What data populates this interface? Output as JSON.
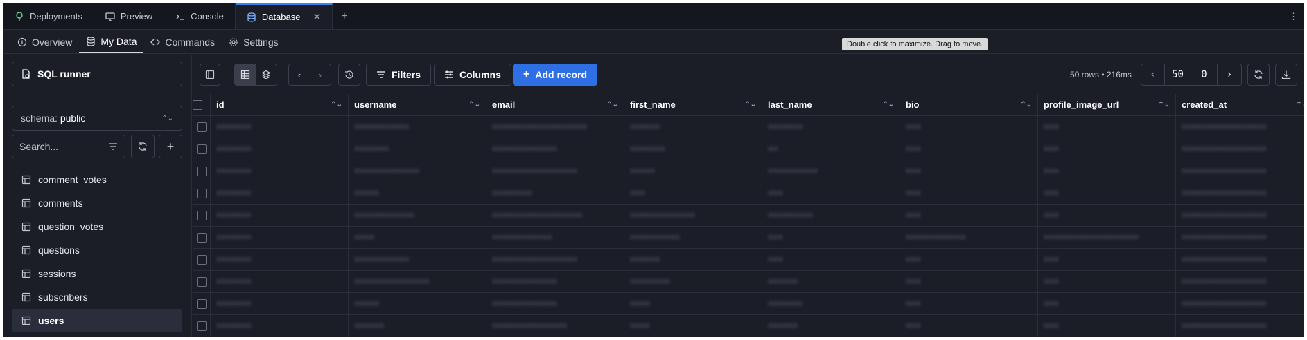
{
  "tabs": [
    {
      "label": "Deployments",
      "icon": "tree-icon"
    },
    {
      "label": "Preview",
      "icon": "monitor-icon"
    },
    {
      "label": "Console",
      "icon": "terminal-icon"
    },
    {
      "label": "Database",
      "icon": "database-icon",
      "active": true
    }
  ],
  "subnav": {
    "overview": "Overview",
    "my_data": "My Data",
    "commands": "Commands",
    "settings": "Settings"
  },
  "tooltip": "Double click to maximize. Drag to move.",
  "sidebar": {
    "sql_runner": "SQL runner",
    "schema_label": "schema:",
    "schema_value": "public",
    "search_placeholder": "Search...",
    "tables": [
      "comment_votes",
      "comments",
      "question_votes",
      "questions",
      "sessions",
      "subscribers",
      "users"
    ],
    "active_table": "users"
  },
  "toolbar": {
    "filters": "Filters",
    "columns": "Columns",
    "add_record": "Add record",
    "rows_info": "50 rows • 216ms",
    "limit": "50",
    "offset": "0"
  },
  "grid": {
    "columns": [
      "id",
      "username",
      "email",
      "first_name",
      "last_name",
      "bio",
      "profile_image_url",
      "created_at"
    ],
    "rows": [
      [
        "•••••••",
        "•••••••••••",
        "•••••••••••••••••••",
        "••••••",
        "•••••••",
        "•••",
        "•••",
        "•••••••••••••••••"
      ],
      [
        "•••••••",
        "•••••••",
        "•••••••••••••",
        "•••••••",
        "••",
        "•••",
        "•••",
        "•••••••••••••••••"
      ],
      [
        "•••••••",
        "•••••••••••••",
        "•••••••••••••••••",
        "•••••",
        "••••••••••",
        "•••",
        "•••",
        "•••••••••••••••••"
      ],
      [
        "•••••••",
        "•••••",
        "••••••••",
        "•••",
        "•••",
        "•••",
        "•••",
        "•••••••••••••••••"
      ],
      [
        "•••••••",
        "••••••••••••",
        "••••••••••••••••••",
        "•••••••••••••",
        "•••••••••",
        "•••",
        "•••",
        "•••••••••••••••••"
      ],
      [
        "•••••••",
        "••••",
        "••••••••••••",
        "••••••••••",
        "•••",
        "••••••••••••",
        "•••••••••••••••••••",
        "•••••••••••••••••"
      ],
      [
        "•••••••",
        "•••••••••••",
        "•••••••••••••••••",
        "••••••",
        "•••",
        "•••",
        "•••",
        "•••••••••••••••••"
      ],
      [
        "•••••••",
        "•••••••••••••••",
        "•••••••••••••",
        "••••••••",
        "••••••",
        "•••",
        "•••",
        "•••••••••••••••••"
      ],
      [
        "•••••••",
        "•••••",
        "•••••••••••••",
        "••••",
        "•••••••",
        "•••",
        "•••",
        "•••••••••••••••••"
      ],
      [
        "•••••••",
        "••••••",
        "•••••••••••••••",
        "••••",
        "••••••",
        "•••",
        "•••",
        "•••••••••••••••••"
      ]
    ]
  }
}
